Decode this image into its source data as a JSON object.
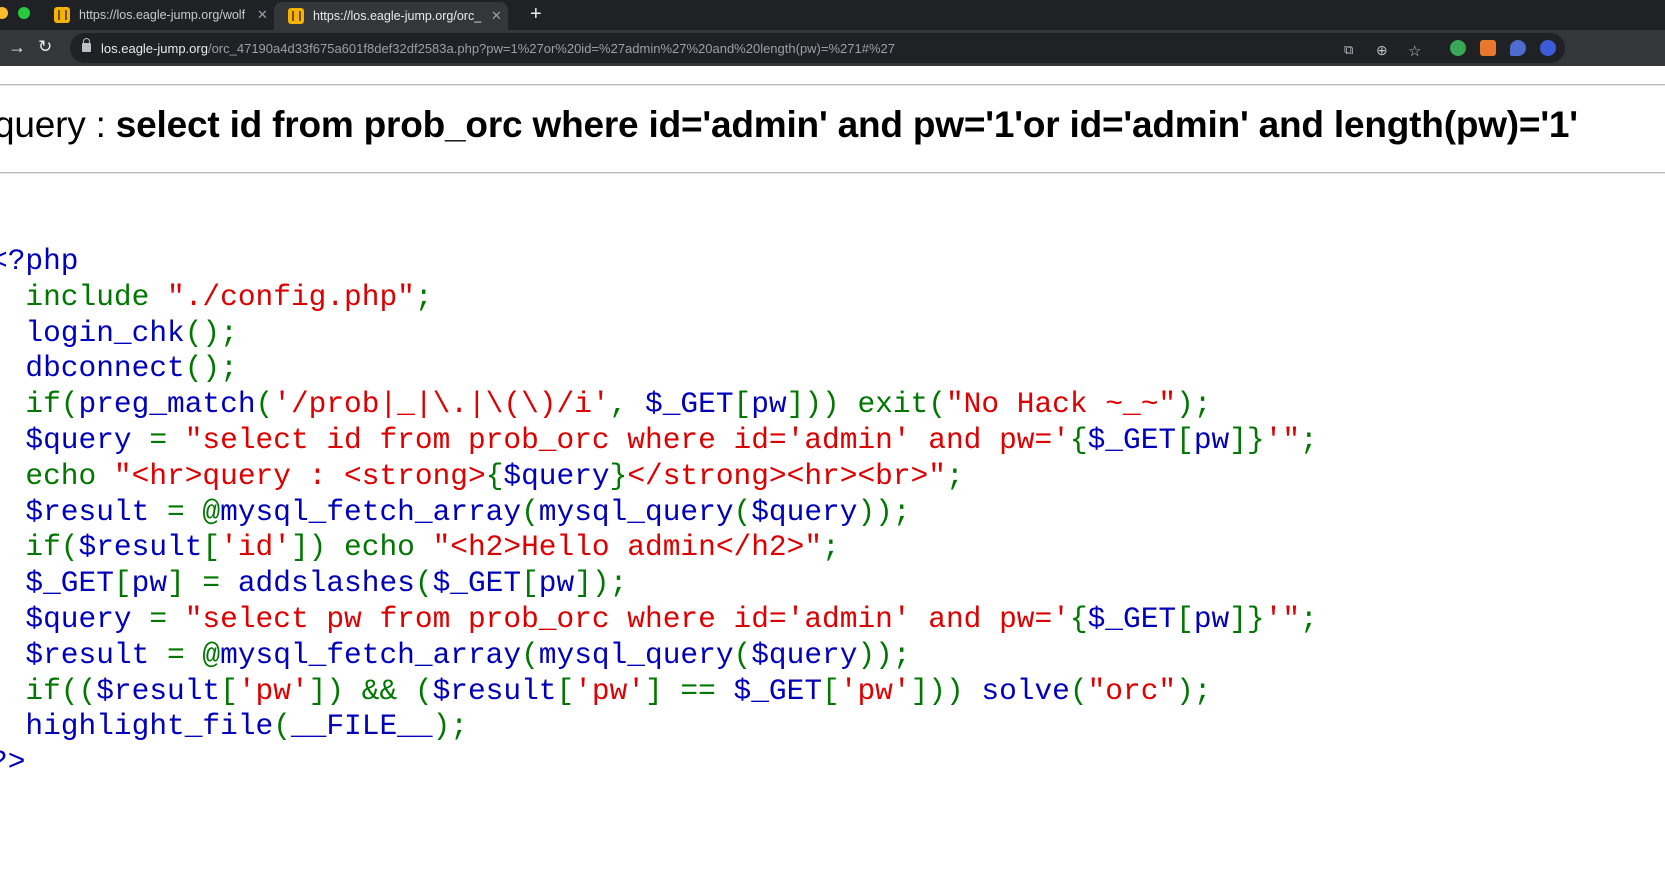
{
  "browser": {
    "tabs": [
      {
        "title": "https://los.eagle-jump.org/wolf",
        "active": false
      },
      {
        "title": "https://los.eagle-jump.org/orc_",
        "active": true
      }
    ],
    "new_tab_label": "+",
    "address_bar": {
      "host": "los.eagle-jump.org",
      "path": "/orc_47190a4d33f675a601f8def32df2583a.php?pw=1%27or%20id=%27admin%27%20and%20length(pw)=%271#%27"
    },
    "icons": [
      "back-icon",
      "reload-icon",
      "lock-icon",
      "translate-icon",
      "zoom-icon",
      "bookmark-star-icon",
      "evernote-icon",
      "extension-icon",
      "shield-extension-icon",
      "profile-icon"
    ]
  },
  "page": {
    "query_label": "query : ",
    "query_text": "select id from prob_orc where id='admin' and pw='1'or id='admin' and length(pw)='1'"
  },
  "code": {
    "colors": {
      "default": "#0000BB",
      "keyword": "#007700",
      "string": "#DD0000"
    },
    "lines": [
      [
        [
          "d",
          "<?php"
        ]
      ],
      [
        [
          "k",
          "  include "
        ],
        [
          "s",
          "\"./config.php\""
        ],
        [
          "k",
          ";"
        ]
      ],
      [
        [
          "d",
          "  login_chk"
        ],
        [
          "k",
          "();"
        ]
      ],
      [
        [
          "d",
          "  dbconnect"
        ],
        [
          "k",
          "();"
        ]
      ],
      [
        [
          "k",
          "  if("
        ],
        [
          "d",
          "preg_match"
        ],
        [
          "k",
          "("
        ],
        [
          "s",
          "'/prob|_|\\.|\\(\\)/i'"
        ],
        [
          "k",
          ", "
        ],
        [
          "d",
          "$_GET"
        ],
        [
          "k",
          "["
        ],
        [
          "d",
          "pw"
        ],
        [
          "k",
          "])) exit("
        ],
        [
          "s",
          "\"No Hack ~_~\""
        ],
        [
          "k",
          ");"
        ]
      ],
      [
        [
          "d",
          "  $query "
        ],
        [
          "k",
          "= "
        ],
        [
          "s",
          "\"select id from prob_orc where id='admin' and pw='"
        ],
        [
          "k",
          "{"
        ],
        [
          "d",
          "$_GET"
        ],
        [
          "k",
          "["
        ],
        [
          "d",
          "pw"
        ],
        [
          "k",
          "]}"
        ],
        [
          "s",
          "'\""
        ],
        [
          "k",
          ";"
        ]
      ],
      [
        [
          "k",
          "  echo "
        ],
        [
          "s",
          "\"<hr>query : <strong>"
        ],
        [
          "k",
          "{"
        ],
        [
          "d",
          "$query"
        ],
        [
          "k",
          "}"
        ],
        [
          "s",
          "</strong><hr><br>\""
        ],
        [
          "k",
          ";"
        ]
      ],
      [
        [
          "d",
          "  $result "
        ],
        [
          "k",
          "= @"
        ],
        [
          "d",
          "mysql_fetch_array"
        ],
        [
          "k",
          "("
        ],
        [
          "d",
          "mysql_query"
        ],
        [
          "k",
          "("
        ],
        [
          "d",
          "$query"
        ],
        [
          "k",
          "));"
        ]
      ],
      [
        [
          "k",
          "  if("
        ],
        [
          "d",
          "$result"
        ],
        [
          "k",
          "["
        ],
        [
          "s",
          "'id'"
        ],
        [
          "k",
          "]) echo "
        ],
        [
          "s",
          "\"<h2>Hello admin</h2>\""
        ],
        [
          "k",
          ";"
        ]
      ],
      [
        [
          "d",
          "  $_GET"
        ],
        [
          "k",
          "["
        ],
        [
          "d",
          "pw"
        ],
        [
          "k",
          "] = "
        ],
        [
          "d",
          "addslashes"
        ],
        [
          "k",
          "("
        ],
        [
          "d",
          "$_GET"
        ],
        [
          "k",
          "["
        ],
        [
          "d",
          "pw"
        ],
        [
          "k",
          "]);"
        ]
      ],
      [
        [
          "d",
          "  $query "
        ],
        [
          "k",
          "= "
        ],
        [
          "s",
          "\"select pw from prob_orc where id='admin' and pw='"
        ],
        [
          "k",
          "{"
        ],
        [
          "d",
          "$_GET"
        ],
        [
          "k",
          "["
        ],
        [
          "d",
          "pw"
        ],
        [
          "k",
          "]}"
        ],
        [
          "s",
          "'\""
        ],
        [
          "k",
          ";"
        ]
      ],
      [
        [
          "d",
          "  $result "
        ],
        [
          "k",
          "= @"
        ],
        [
          "d",
          "mysql_fetch_array"
        ],
        [
          "k",
          "("
        ],
        [
          "d",
          "mysql_query"
        ],
        [
          "k",
          "("
        ],
        [
          "d",
          "$query"
        ],
        [
          "k",
          "));"
        ]
      ],
      [
        [
          "k",
          "  if(("
        ],
        [
          "d",
          "$result"
        ],
        [
          "k",
          "["
        ],
        [
          "s",
          "'pw'"
        ],
        [
          "k",
          "]) && ("
        ],
        [
          "d",
          "$result"
        ],
        [
          "k",
          "["
        ],
        [
          "s",
          "'pw'"
        ],
        [
          "k",
          "] == "
        ],
        [
          "d",
          "$_GET"
        ],
        [
          "k",
          "["
        ],
        [
          "s",
          "'pw'"
        ],
        [
          "k",
          "])) "
        ],
        [
          "d",
          "solve"
        ],
        [
          "k",
          "("
        ],
        [
          "s",
          "\"orc\""
        ],
        [
          "k",
          ");"
        ]
      ],
      [
        [
          "d",
          "  highlight_file"
        ],
        [
          "k",
          "("
        ],
        [
          "d",
          "__FILE__"
        ],
        [
          "k",
          ");"
        ]
      ],
      [
        [
          "d",
          "?>"
        ]
      ]
    ]
  }
}
